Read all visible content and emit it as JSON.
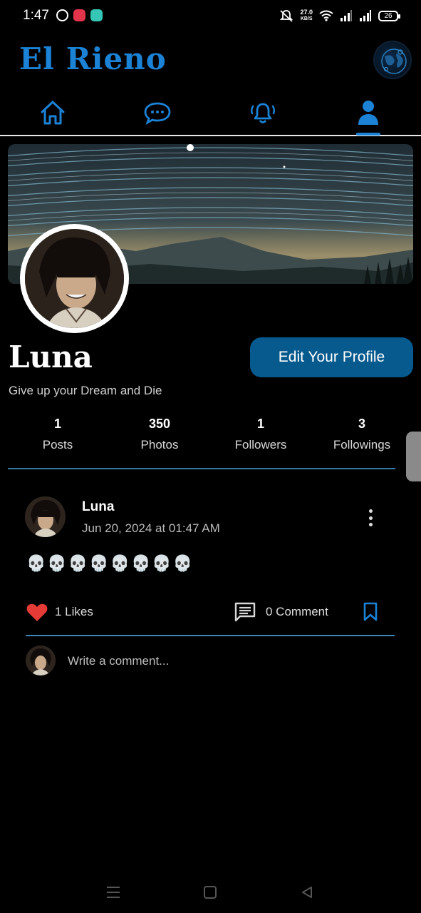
{
  "status_bar": {
    "time": "1:47",
    "net_speed_value": "27.0",
    "net_speed_unit": "KB/S",
    "battery": "26"
  },
  "header": {
    "app_title": "El Rieno"
  },
  "nav": {
    "tabs": [
      "home",
      "messages",
      "notifications",
      "profile"
    ],
    "active_tab": "profile",
    "accent_color": "#1b82d6"
  },
  "profile": {
    "name": "Luna",
    "bio": "Give up your Dream and Die",
    "edit_button": "Edit Your Profile",
    "stats": [
      {
        "value": "1",
        "label": "Posts"
      },
      {
        "value": "350",
        "label": "Photos"
      },
      {
        "value": "1",
        "label": "Followers"
      },
      {
        "value": "3",
        "label": "Followings"
      }
    ]
  },
  "post": {
    "author": "Luna",
    "date": "Jun 20, 2024 at 01:47 AM",
    "body": "💀💀💀💀💀💀💀💀",
    "likes": "1 Likes",
    "comments": "0 Comment",
    "comment_placeholder": "Write a comment..."
  }
}
